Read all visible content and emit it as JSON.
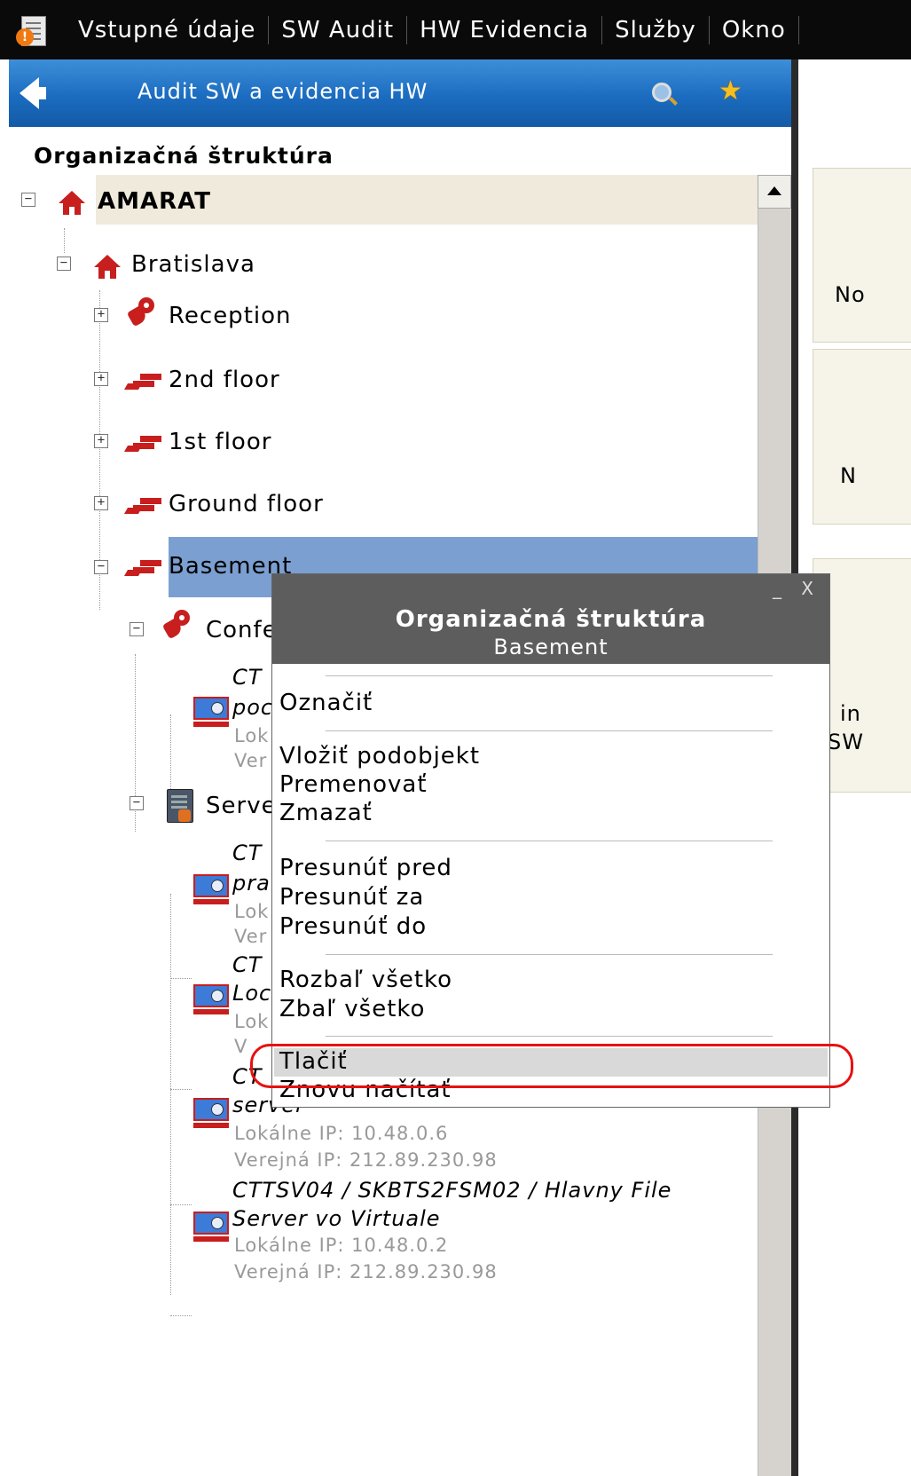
{
  "menubar": {
    "items": [
      "Vstupné údaje",
      "SW Audit",
      "HW Evidencia",
      "Služby",
      "Okno"
    ]
  },
  "panel": {
    "header_title": "Audit SW a evidencia HW",
    "section_title": "Organizačná štruktúra"
  },
  "tree": {
    "root": "AMARAT",
    "city": "Bratislava",
    "reception": "Reception",
    "floor2": "2nd floor",
    "floor1": "1st floor",
    "ground": "Ground floor",
    "basement": "Basement",
    "conference": "Confe",
    "serverroom": "Serve",
    "dev1": {
      "l1": "CT",
      "l2": "poc",
      "l3": "Lok",
      "l4": "Ver"
    },
    "dev2": {
      "l1": "CT",
      "l2": "pra",
      "l3": "Lok",
      "l4": "Ver"
    },
    "dev3": {
      "l1": "CT",
      "l2": "Loc",
      "l3": "Lok",
      "l4": "V"
    },
    "dev4": {
      "l1": "CT",
      "l2": "server",
      "l3": "Lokálne IP: 10.48.0.6",
      "l4": "Verejná IP: 212.89.230.98"
    },
    "dev5": {
      "l1": "CTTSV04 / SKBTS2FSM02 / Hlavny File",
      "l2": "Server vo Virtuale",
      "l3": "Lokálne IP: 10.48.0.2",
      "l4": "Verejná IP: 212.89.230.98"
    }
  },
  "right": {
    "card1": "No",
    "card2": "N",
    "card3a": "in",
    "card3b": "SW"
  },
  "popup": {
    "controls": "_ X",
    "title": "Organizačná štruktúra",
    "subtitle": "Basement",
    "items": {
      "mark": "Označiť",
      "insert": "Vložiť podobjekt",
      "rename": "Premenovať",
      "delete": "Zmazať",
      "move_before": "Presunúť pred",
      "move_after": "Presunúť za",
      "move_into": "Presunúť do",
      "expand_all": "Rozbaľ všetko",
      "collapse_all": "Zbaľ všetko",
      "print": "Tlačiť",
      "reload": "Znovu načítať"
    }
  },
  "colors": {
    "header_blue": "#1b6cc0",
    "selection": "#7b9fd0",
    "icon_red": "#c81e1e",
    "highlight_ring": "#e81010"
  }
}
